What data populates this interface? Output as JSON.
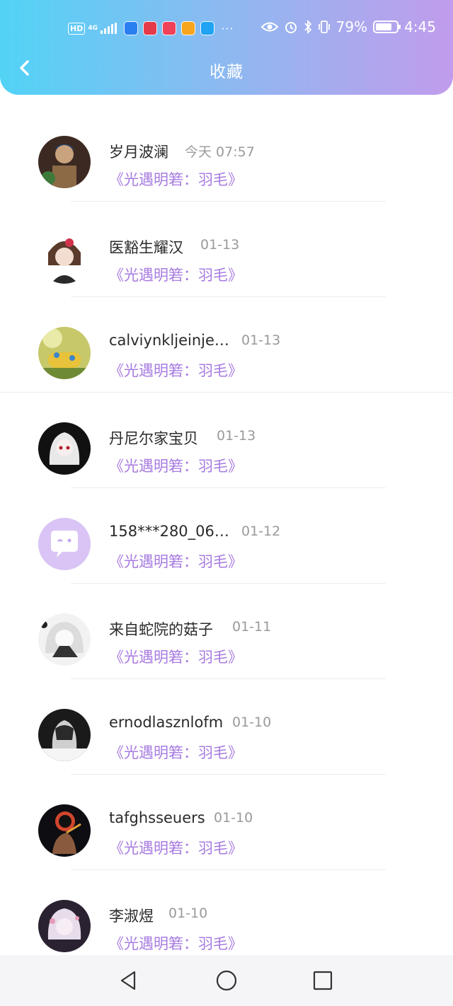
{
  "status_bar": {
    "hd": "HD",
    "network": "4G",
    "battery": "79%",
    "time": "4:45",
    "icons": [
      "hd-icon",
      "signal-icon",
      "bulb-app-icon",
      "game-app-icon",
      "book-app-icon",
      "gift-app-icon",
      "search-app-icon",
      "more-dots-icon",
      "eye-icon",
      "alarm-icon",
      "bluetooth-icon",
      "vibrate-icon",
      "battery-icon"
    ]
  },
  "header": {
    "title": "收藏",
    "back_icon": "chevron-left-icon",
    "gradient": [
      "#52d3f6",
      "#c19cec"
    ]
  },
  "accent_color": "#a77be0",
  "items": [
    {
      "name": "岁月波澜",
      "time": "今天 07:57",
      "collection": "《光遇明箬：羽毛》"
    },
    {
      "name": "医豁生耀汉",
      "time": "01-13",
      "collection": "《光遇明箬：羽毛》"
    },
    {
      "name": "calviynkljeinje…",
      "time": "01-13",
      "collection": "《光遇明箬：羽毛》"
    },
    {
      "name": "丹尼尔家宝贝",
      "time": "01-13",
      "collection": "《光遇明箬：羽毛》"
    },
    {
      "name": "158***280_06…",
      "time": "01-12",
      "collection": "《光遇明箬：羽毛》"
    },
    {
      "name": "来自蛇院的菇子",
      "time": "01-11",
      "collection": "《光遇明箬：羽毛》"
    },
    {
      "name": "ernodlasznlofm",
      "time": "01-10",
      "collection": "《光遇明箬：羽毛》"
    },
    {
      "name": "tafghsseuers",
      "time": "01-10",
      "collection": "《光遇明箬：羽毛》"
    },
    {
      "name": "李淑煜",
      "time": "01-10",
      "collection": "《光遇明箬：羽毛》"
    }
  ],
  "nav": {
    "icons": [
      "back-triangle-icon",
      "home-circle-icon",
      "recents-square-icon"
    ]
  }
}
